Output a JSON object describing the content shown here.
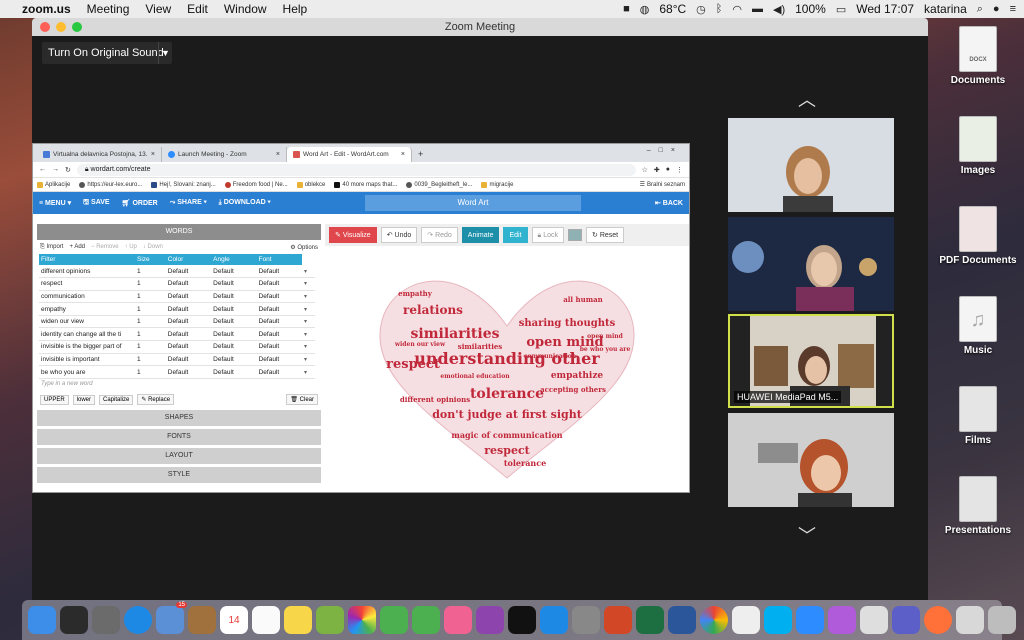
{
  "menubar": {
    "app": "zoom.us",
    "menus": [
      "Meeting",
      "View",
      "Edit",
      "Window",
      "Help"
    ],
    "temperature": "68°C",
    "battery": "100%",
    "clock": "Wed 17:07",
    "user": "katarina"
  },
  "zoom": {
    "window_title": "Zoom Meeting",
    "original_sound_label": "Turn On Original Sound"
  },
  "browser": {
    "tabs": [
      "Virtualna delavnica Postojna, 13.",
      "Launch Meeting - Zoom",
      "Word Art - Edit - WordArt.com"
    ],
    "url": "wordart.com/create",
    "bookmarks": [
      "Aplikacije",
      "https://eur-lex.euro...",
      "Hej!, Slovani: znanj...",
      "Freedom food | Ne...",
      "oblekce",
      "40 more maps that...",
      "0039_Begleitheft_le...",
      "migracije"
    ],
    "bookmarks_right": "Bralni seznam"
  },
  "wordart": {
    "nav": {
      "menu": "MENU",
      "save": "SAVE",
      "order": "ORDER",
      "share": "SHARE",
      "download": "DOWNLOAD",
      "title": "Word Art",
      "back": "BACK"
    },
    "words_header": "WORDS",
    "toolbar": {
      "import": "Import",
      "add": "Add",
      "remove": "Remove",
      "up": "Up",
      "down": "Down",
      "options": "Options"
    },
    "columns": [
      "Filter",
      "Size",
      "Color",
      "Angle",
      "Font"
    ],
    "rows": [
      {
        "word": "different opinions",
        "size": "1",
        "color": "Default",
        "angle": "Default",
        "font": "Default"
      },
      {
        "word": "respect",
        "size": "1",
        "color": "Default",
        "angle": "Default",
        "font": "Default"
      },
      {
        "word": "communication",
        "size": "1",
        "color": "Default",
        "angle": "Default",
        "font": "Default"
      },
      {
        "word": "empathy",
        "size": "1",
        "color": "Default",
        "angle": "Default",
        "font": "Default"
      },
      {
        "word": "widen our view",
        "size": "1",
        "color": "Default",
        "angle": "Default",
        "font": "Default"
      },
      {
        "word": "identity can change all the ti",
        "size": "1",
        "color": "Default",
        "angle": "Default",
        "font": "Default"
      },
      {
        "word": "invisible is the bigger part of",
        "size": "1",
        "color": "Default",
        "angle": "Default",
        "font": "Default"
      },
      {
        "word": "invisible is important",
        "size": "1",
        "color": "Default",
        "angle": "Default",
        "font": "Default"
      },
      {
        "word": "be who you are",
        "size": "1",
        "color": "Default",
        "angle": "Default",
        "font": "Default"
      }
    ],
    "new_word_placeholder": "Type in a new word",
    "case_buttons": {
      "upper": "UPPER",
      "lower": "lower",
      "capitalize": "Capitalize",
      "replace": "Replace",
      "clear": "Clear"
    },
    "accordion": [
      "SHAPES",
      "FONTS",
      "LAYOUT",
      "STYLE"
    ],
    "vis_toolbar": {
      "visualize": "Visualize",
      "undo": "Undo",
      "redo": "Redo",
      "animate": "Animate",
      "edit": "Edit",
      "lock": "Lock",
      "reset": "Reset"
    },
    "cloud_words": [
      "understanding other",
      "similarities",
      "tolerance",
      "respect",
      "open mind",
      "relations",
      "sharing thoughts",
      "don't judge at first sight",
      "empathize",
      "all human",
      "magic of communication",
      "empathy",
      "accepting others",
      "emotional education",
      "different opinions",
      "widen our view",
      "open mind",
      "be who you are",
      "respect",
      "tolerance",
      "similarities",
      "communication"
    ],
    "heart_color": "#c0283a"
  },
  "participants": [
    {
      "name": "",
      "bg": "#cfd6dc"
    },
    {
      "name": "",
      "bg": "#2a3550"
    },
    {
      "name": "HUAWEI MediaPad M5...",
      "bg": "#d8d2c6"
    },
    {
      "name": "",
      "bg": "#c9c9c9"
    }
  ],
  "desktop": [
    "Documents",
    "Images",
    "PDF Documents",
    "Music",
    "Films",
    "Presentations"
  ],
  "desktop_badge": "DOCX",
  "dock_badge": "15",
  "dock_calendar_day": "14"
}
